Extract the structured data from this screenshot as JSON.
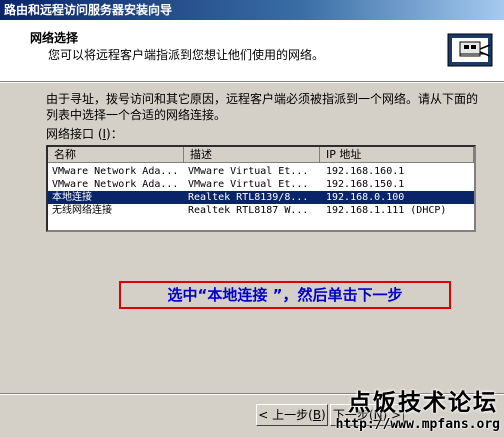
{
  "window": {
    "title": "路由和远程访问服务器安装向导"
  },
  "header": {
    "title": "网络选择",
    "subtitle": "您可以将远程客户端指派到您想让他们使用的网络。",
    "icon": "network-adapter-icon"
  },
  "intro": "由于寻址，拨号访问和其它原因，远程客户端必须被指派到一个网络。请从下面的列表中选择一个合适的网络连接。",
  "interfaces": {
    "label_pre": "网络接口 (",
    "label_key": "I",
    "label_post": ")：",
    "columns": [
      "名称",
      "描述",
      "IP 地址"
    ],
    "rows": [
      {
        "name": "VMware Network Ada...",
        "desc": "VMware Virtual Et...",
        "ip": "192.168.160.1",
        "selected": false
      },
      {
        "name": "VMware Network Ada...",
        "desc": "VMware Virtual Et...",
        "ip": "192.168.150.1",
        "selected": false
      },
      {
        "name": "本地连接",
        "desc": "Realtek RTL8139/8...",
        "ip": "192.168.0.100",
        "selected": true
      },
      {
        "name": "无线网络连接",
        "desc": "Realtek RTL8187 W...",
        "ip": "192.168.1.111 (DHCP)",
        "selected": false
      }
    ]
  },
  "annotation": {
    "text": "选中“本地连接 ”，然后单击下一步",
    "border_color": "#e00000",
    "text_color": "#0000cc"
  },
  "buttons": {
    "back_pre": "< 上一步(",
    "back_key": "B",
    "back_post": ")",
    "next_pre": "下一步(",
    "next_key": "N",
    "next_post": ") >"
  },
  "watermark": {
    "title": "点饭技术论坛",
    "url": "http://www.mpfans.org"
  }
}
